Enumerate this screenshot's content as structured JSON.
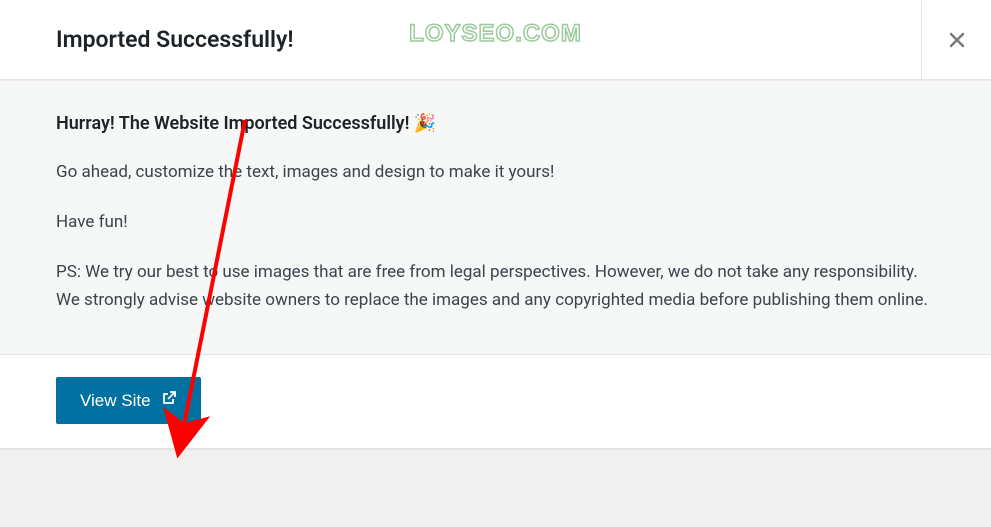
{
  "header": {
    "title": "Imported Successfully!",
    "watermark": "LOYSEO.COM"
  },
  "body": {
    "success_heading": "Hurray! The Website Imported Successfully! 🎉",
    "text_customize": "Go ahead, customize the text, images and design to make it yours!",
    "text_havefun": "Have fun!",
    "text_ps": "PS: We try our best to use images that are free from legal perspectives. However, we do not take any responsibility. We strongly advise website owners to replace the images and any copyrighted media before publishing them online."
  },
  "footer": {
    "view_site_label": "View Site"
  },
  "colors": {
    "primary_button": "#0071a1",
    "text_dark": "#1d2327",
    "text_body": "#3c434a",
    "arrow": "#ff0000"
  }
}
